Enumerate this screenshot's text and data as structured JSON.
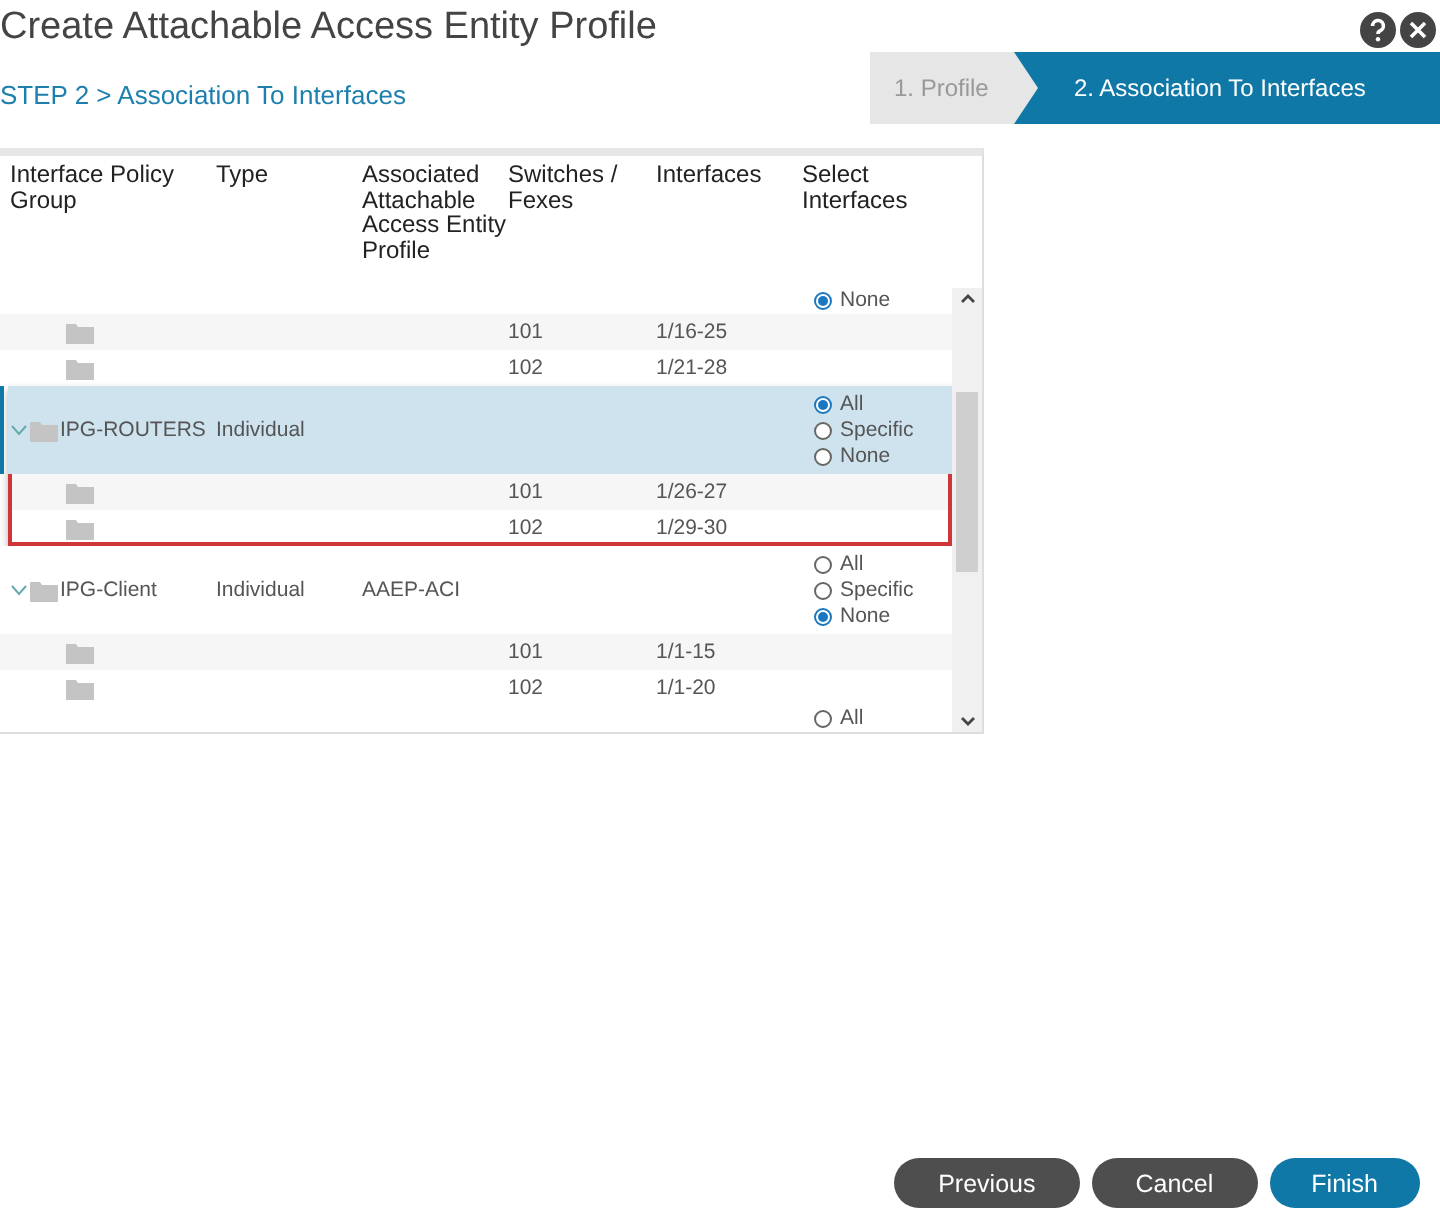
{
  "dialog": {
    "title": "Create Attachable Access Entity Profile"
  },
  "step_label": "STEP 2 > Association To Interfaces",
  "wizard_steps": [
    {
      "label": "1. Profile",
      "selected": false
    },
    {
      "label": "2. Association To Interfaces",
      "selected": true
    }
  ],
  "table": {
    "columns": [
      "Interface Policy Group",
      "Type",
      "Associated Attachable Access Entity Profile",
      "Switches / Fexes",
      "Interfaces",
      "Select Interfaces"
    ],
    "groups": [
      {
        "options": [
          {
            "label": "None",
            "selected": true
          }
        ],
        "children": [
          {
            "switch": "101",
            "interfaces": "1/16-25"
          },
          {
            "switch": "102",
            "interfaces": "1/21-28"
          }
        ]
      },
      {
        "name": "IPG-ROUTERS",
        "type": "Individual",
        "expanded": true,
        "selected": true,
        "options": [
          {
            "label": "All",
            "selected": true
          },
          {
            "label": "Specific",
            "selected": false
          },
          {
            "label": "None",
            "selected": false
          }
        ],
        "children": [
          {
            "switch": "101",
            "interfaces": "1/26-27"
          },
          {
            "switch": "102",
            "interfaces": "1/29-30"
          }
        ]
      },
      {
        "name": "IPG-Client",
        "type": "Individual",
        "aaep": "AAEP-ACI",
        "expanded": true,
        "selected": false,
        "options": [
          {
            "label": "All",
            "selected": false
          },
          {
            "label": "Specific",
            "selected": false
          },
          {
            "label": "None",
            "selected": true
          }
        ],
        "children": [
          {
            "switch": "101",
            "interfaces": "1/1-15"
          },
          {
            "switch": "102",
            "interfaces": "1/1-20"
          }
        ]
      },
      {
        "options": [
          {
            "label": "All",
            "selected": false
          }
        ]
      }
    ]
  },
  "buttons": [
    {
      "label": "Previous",
      "kind": "secondary"
    },
    {
      "label": "Cancel",
      "kind": "secondary"
    },
    {
      "label": "Finish",
      "kind": "primary"
    }
  ]
}
